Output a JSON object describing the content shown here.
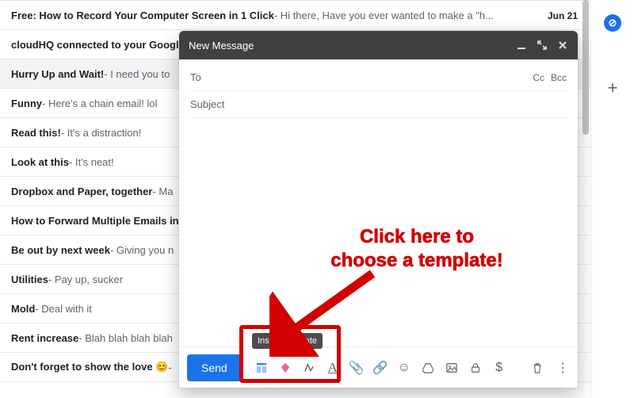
{
  "emails": [
    {
      "subject": "Free: How to Record Your Computer Screen in 1 Click",
      "preview": " - Hi there, Have you ever wanted to make a \"h...",
      "date": "Jun 21"
    },
    {
      "subject": "cloudHQ connected to your Googl",
      "preview": ""
    },
    {
      "subject": "Hurry Up and Wait!",
      "preview": " - I need you to "
    },
    {
      "subject": "Funny",
      "preview": " - Here's a chain email! lol"
    },
    {
      "subject": "Read this!",
      "preview": " - It's a distraction!"
    },
    {
      "subject": "Look at this",
      "preview": " - It's neat!"
    },
    {
      "subject": "Dropbox and Paper, together",
      "preview": " - Ma"
    },
    {
      "subject": "How to Forward Multiple Emails in",
      "preview": ""
    },
    {
      "subject": "Be out by next week",
      "preview": " - Giving you n"
    },
    {
      "subject": "Utilities",
      "preview": " - Pay up, sucker"
    },
    {
      "subject": "Mold",
      "preview": " - Deal with it"
    },
    {
      "subject": "Rent increase",
      "preview": " - Blah blah blah blah"
    },
    {
      "subject": "Don't forget to show the love 😊",
      "preview": " - "
    }
  ],
  "compose": {
    "title": "New Message",
    "to_label": "To",
    "cc_label": "Cc",
    "bcc_label": "Bcc",
    "subject_label": "Subject",
    "send_label": "Send"
  },
  "tooltip": "Insert Template",
  "annotation": {
    "line1": "Click here to",
    "line2": "choose a template!"
  },
  "side": {
    "badge_glyph": "⊘",
    "plus_glyph": "+"
  },
  "icons": {
    "attach": "📎",
    "link": "🔗",
    "emoji": "☺",
    "drive": "▲",
    "image": "🖼",
    "lock": "🔒",
    "dollar": "$",
    "trash": "🗑",
    "more": "⋮"
  }
}
